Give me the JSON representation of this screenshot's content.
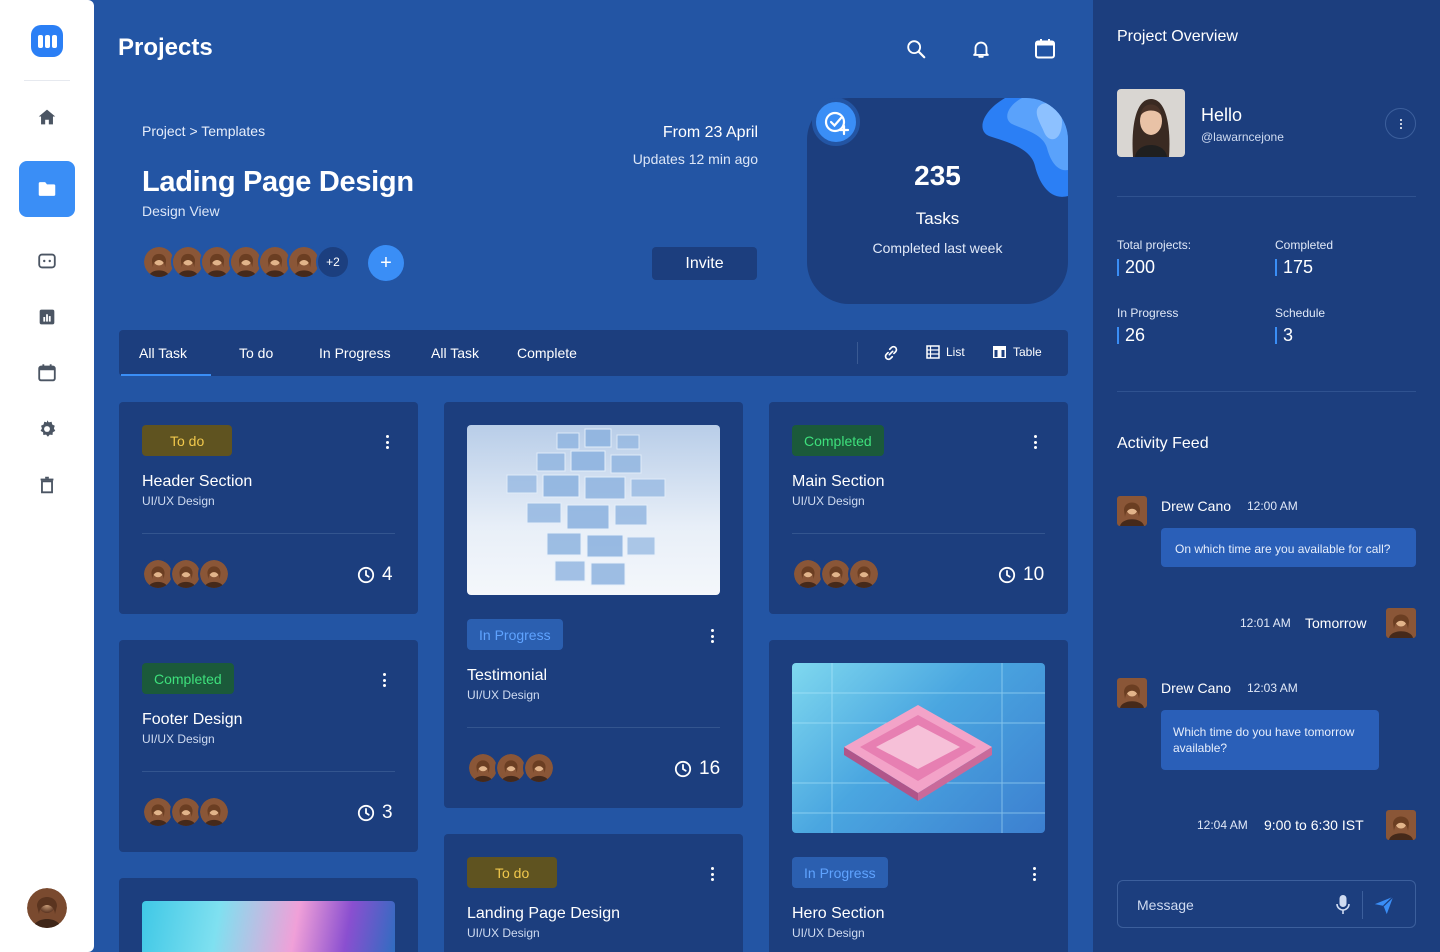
{
  "header": {
    "title": "Projects"
  },
  "project": {
    "breadcrumb": "Project > Templates",
    "title": "Lading Page Design",
    "subtitle": "Design View",
    "from_date": "From 23 April",
    "updated": "Updates 12 min ago",
    "extra_members": "+2",
    "add_label": "+",
    "invite_label": "Invite"
  },
  "stats_card": {
    "count": "235",
    "label": "Tasks",
    "sub": "Completed last week"
  },
  "tabs": {
    "items": [
      "All Task",
      "To do",
      "In Progress",
      "All Task",
      "Complete"
    ],
    "list_label": "List",
    "table_label": "Table"
  },
  "cards": [
    {
      "status": "To do",
      "title": "Header Section",
      "sub": "UI/UX Design",
      "count": "4"
    },
    {
      "status": "Completed",
      "title": "Footer Design",
      "sub": "UI/UX Design",
      "count": "3"
    },
    {
      "status": "In Progress",
      "title": "Testimonial",
      "sub": "UI/UX Design",
      "count": "16"
    },
    {
      "status": "To do",
      "title": "Landing Page Design",
      "sub": "UI/UX Design"
    },
    {
      "status": "Completed",
      "title": "Main Section",
      "sub": "UI/UX Design",
      "count": "10"
    },
    {
      "status": "In Progress",
      "title": "Hero Section",
      "sub": "UI/UX Design"
    }
  ],
  "overview": {
    "title": "Project Overview",
    "hello": "Hello",
    "handle": "@lawarncejone",
    "stats": [
      {
        "label": "Total projects:",
        "value": "200"
      },
      {
        "label": "Completed",
        "value": "175"
      },
      {
        "label": "In Progress",
        "value": "26"
      },
      {
        "label": "Schedule",
        "value": "3"
      }
    ]
  },
  "feed": {
    "title": "Activity Feed",
    "items": [
      {
        "name": "Drew Cano",
        "time": "12:00 AM",
        "message": "On which time are you available for call?"
      },
      {
        "name": "Tomorrow",
        "time": "12:01 AM"
      },
      {
        "name": "Drew Cano",
        "time": "12:03 AM",
        "message": "Which time do you have tomorrow available?"
      },
      {
        "name": "9:00 to 6:30 IST",
        "time": "12:04 AM"
      }
    ],
    "message_placeholder": "Message"
  },
  "colors": {
    "background": "#2355a4",
    "panel": "#1c3e7e",
    "accent": "#3a8ef6"
  }
}
